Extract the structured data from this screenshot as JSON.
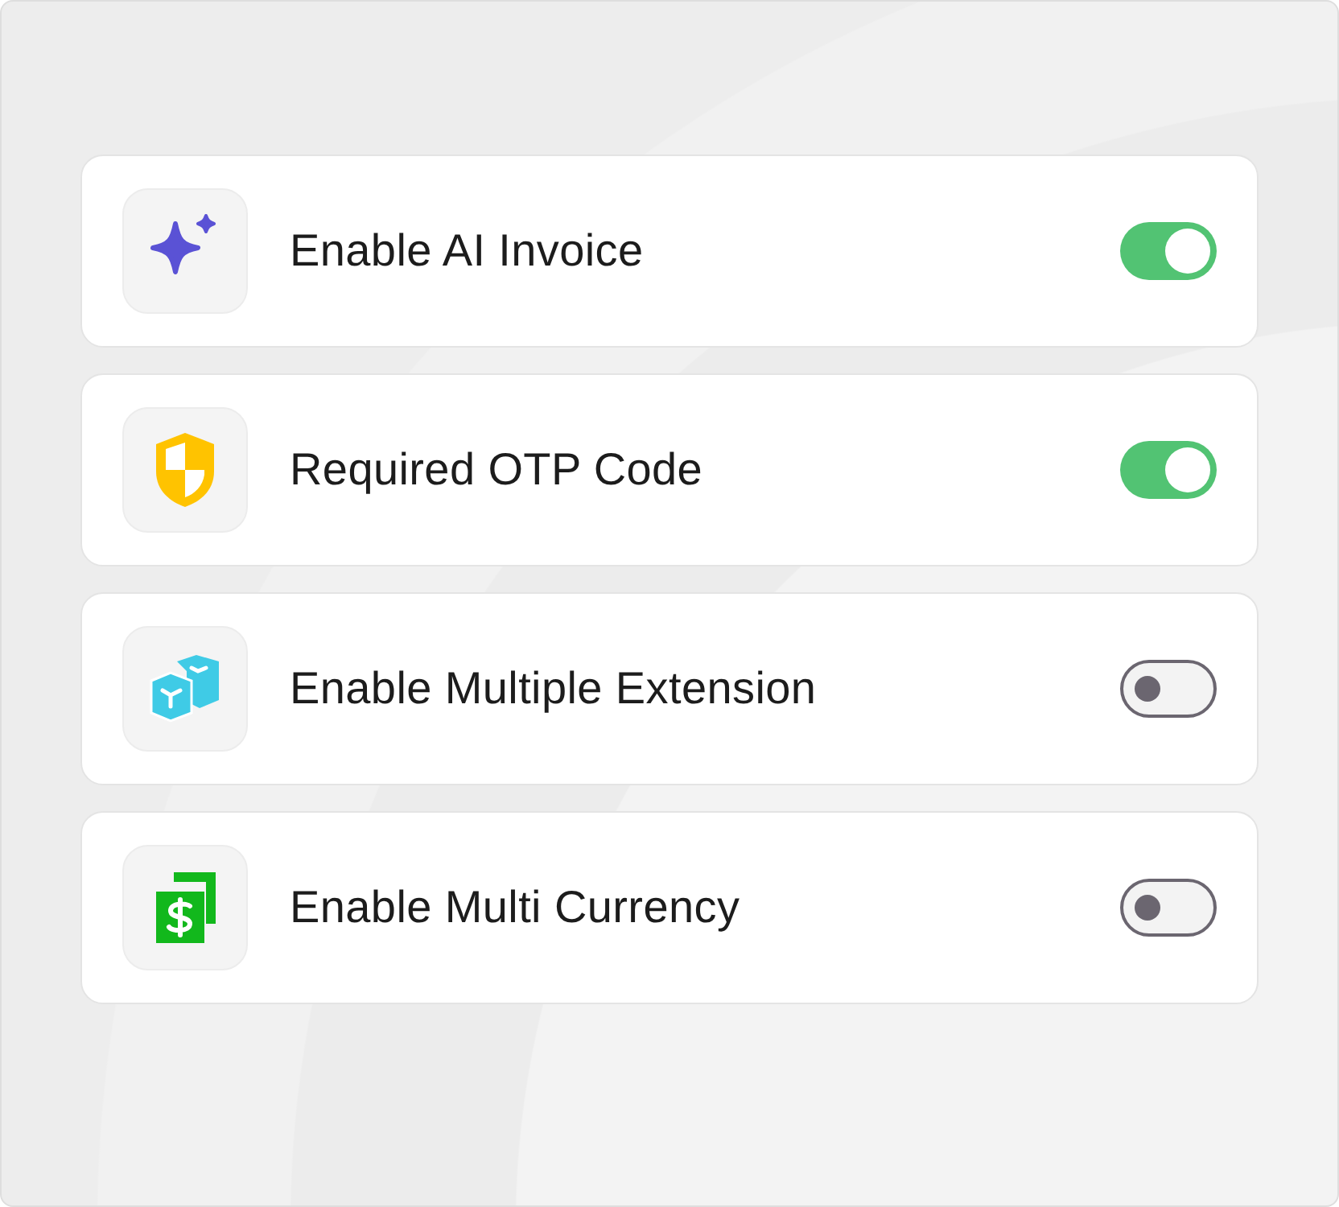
{
  "settings": [
    {
      "kind": "sparkle",
      "label": "Enable AI Invoice",
      "on": true
    },
    {
      "kind": "shield",
      "label": "Required OTP Code",
      "on": true
    },
    {
      "kind": "cubes",
      "label": "Enable Multiple Extension",
      "on": false
    },
    {
      "kind": "money",
      "label": "Enable Multi Currency",
      "on": false
    }
  ]
}
